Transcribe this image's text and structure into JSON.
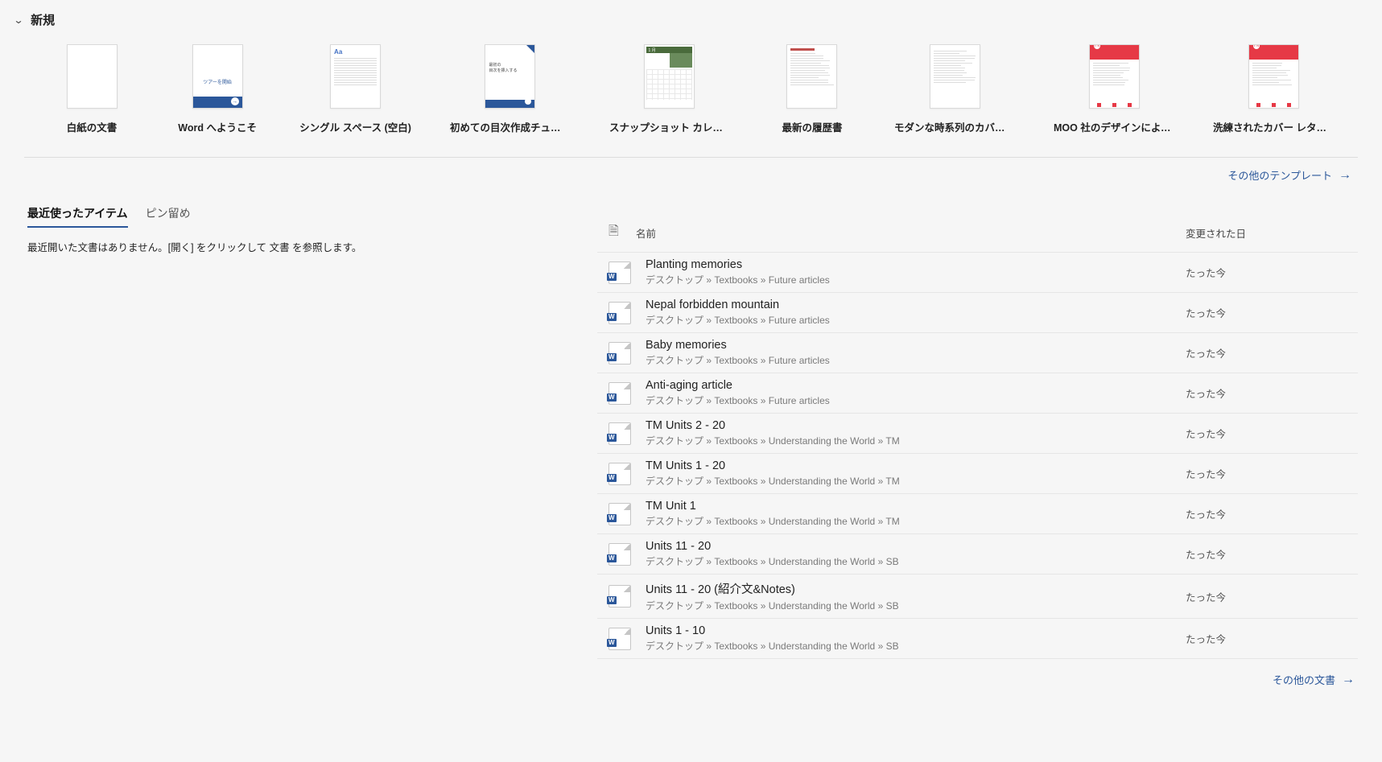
{
  "header": {
    "title": "新規"
  },
  "templates": [
    {
      "label": "白紙の文書",
      "kind": "blank"
    },
    {
      "label": "Word へようこそ",
      "kind": "welcome",
      "thumb_text": "ツアーを開始"
    },
    {
      "label": "シングル スペース (空白)",
      "kind": "single"
    },
    {
      "label": "初めての目次作成チュートリアル",
      "kind": "toc",
      "thumb_line1": "最初の",
      "thumb_line2": "目次を挿入する"
    },
    {
      "label": "スナップショット カレンダー",
      "kind": "calendar",
      "thumb_header": "1 月"
    },
    {
      "label": "最新の履歴書",
      "kind": "resume"
    },
    {
      "label": "モダンな時系列のカバー レター",
      "kind": "cover"
    },
    {
      "label": "MOO 社のデザインによる洗…",
      "kind": "moo",
      "logo_text": "YN"
    },
    {
      "label": "洗練されたカバー レター (デザ…",
      "kind": "moo2",
      "logo_text": "YN"
    }
  ],
  "more_templates_link": "その他のテンプレート",
  "tabs": {
    "recent": "最近使ったアイテム",
    "pinned": "ピン留め"
  },
  "empty_recent_message": "最近開いた文書はありません。[開く] をクリックして 文書 を参照します。",
  "file_table": {
    "col_name": "名前",
    "col_modified": "変更された日"
  },
  "files": [
    {
      "name": "Planting memories",
      "path": "デスクトップ » Textbooks » Future articles",
      "modified": "たった今"
    },
    {
      "name": "Nepal forbidden mountain",
      "path": "デスクトップ » Textbooks » Future articles",
      "modified": "たった今"
    },
    {
      "name": "Baby memories",
      "path": "デスクトップ » Textbooks » Future articles",
      "modified": "たった今"
    },
    {
      "name": "Anti-aging article",
      "path": "デスクトップ » Textbooks » Future articles",
      "modified": "たった今"
    },
    {
      "name": "TM Units 2 - 20",
      "path": "デスクトップ » Textbooks » Understanding the World » TM",
      "modified": "たった今"
    },
    {
      "name": "TM Units 1 - 20",
      "path": "デスクトップ » Textbooks » Understanding the World » TM",
      "modified": "たった今"
    },
    {
      "name": "TM Unit 1",
      "path": "デスクトップ » Textbooks » Understanding the World » TM",
      "modified": "たった今"
    },
    {
      "name": "Units 11 - 20",
      "path": "デスクトップ » Textbooks » Understanding the World » SB",
      "modified": "たった今"
    },
    {
      "name": "Units 11 - 20 (紹介文&Notes)",
      "path": "デスクトップ » Textbooks » Understanding the World » SB",
      "modified": "たった今"
    },
    {
      "name": "Units 1 - 10",
      "path": "デスクトップ » Textbooks » Understanding the World » SB",
      "modified": "たった今"
    }
  ],
  "more_documents_link": "その他の文書"
}
